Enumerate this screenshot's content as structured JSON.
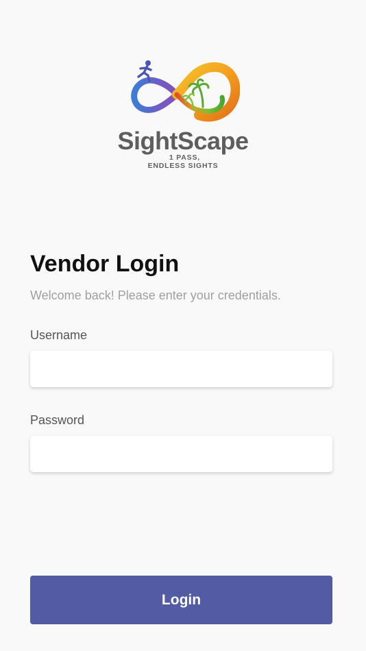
{
  "brand": {
    "name": "SightScape",
    "tagline_line1": "1 PASS,",
    "tagline_line2": "ENDLESS SIGHTS"
  },
  "login": {
    "title": "Vendor Login",
    "subtitle": "Welcome back! Please enter your credentials.",
    "username_label": "Username",
    "username_value": "",
    "password_label": "Password",
    "password_value": "",
    "button_label": "Login"
  },
  "colors": {
    "background": "#f9f9f9",
    "primary_button": "#525ba4",
    "brand_text": "#5e5e5e",
    "subtitle_text": "#a0a0a0"
  }
}
